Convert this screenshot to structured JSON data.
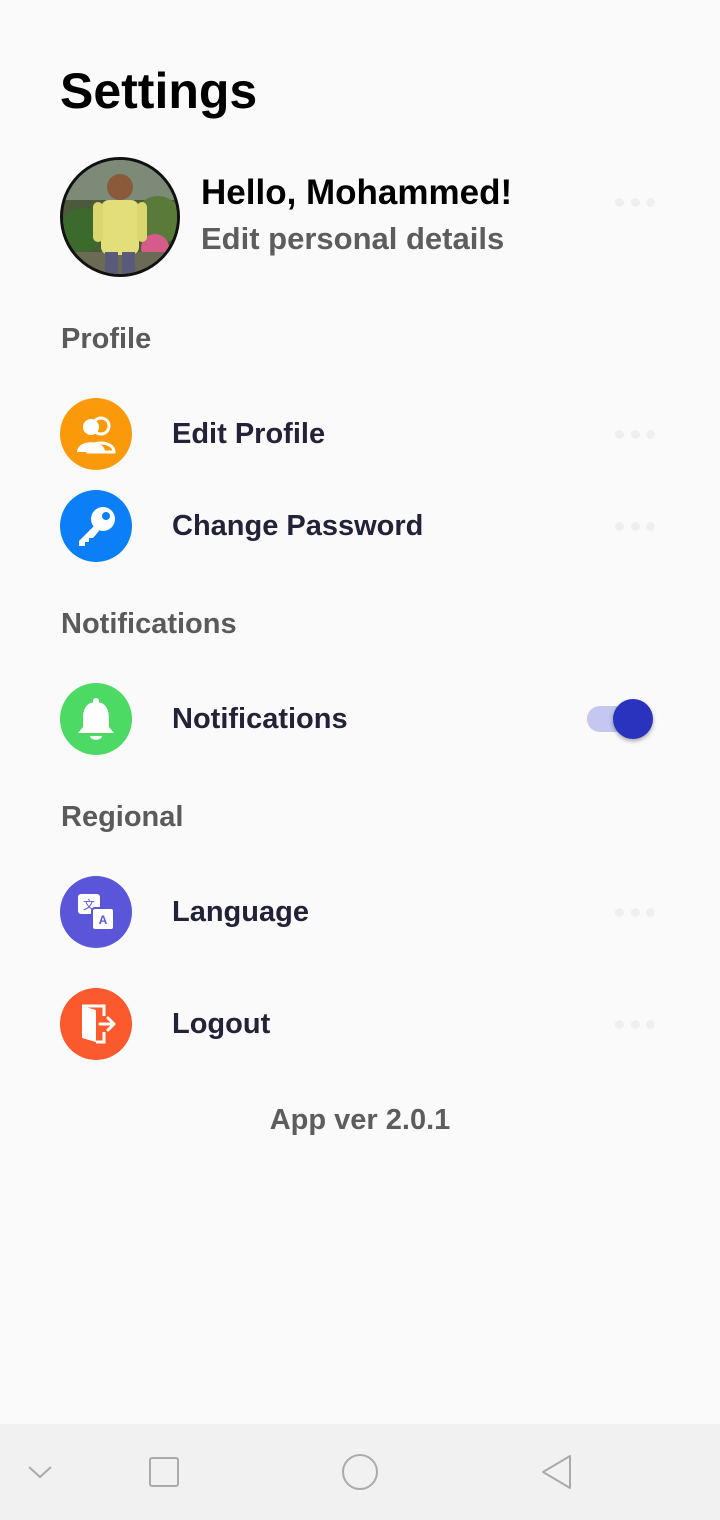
{
  "header": {
    "title": "Settings"
  },
  "profile": {
    "greeting": "Hello, Mohammed!",
    "subtitle": "Edit personal details"
  },
  "sections": {
    "profile": {
      "label": "Profile",
      "items": [
        {
          "label": "Edit Profile",
          "icon": "users-icon",
          "color": "#fa9a0b"
        },
        {
          "label": "Change Password",
          "icon": "key-icon",
          "color": "#0a7ff8"
        }
      ]
    },
    "notifications": {
      "label": "Notifications",
      "items": [
        {
          "label": "Notifications",
          "icon": "bell-icon",
          "color": "#4cd964",
          "toggle_on": true
        }
      ]
    },
    "regional": {
      "label": "Regional",
      "items": [
        {
          "label": "Language",
          "icon": "translate-icon",
          "color": "#5a55d9"
        },
        {
          "label": "Logout",
          "icon": "logout-icon",
          "color": "#fb5a2c"
        }
      ]
    }
  },
  "footer": {
    "version": "App ver 2.0.1"
  },
  "colors": {
    "toggle_track": "#c4c7ef",
    "toggle_thumb": "#2a33bd"
  }
}
